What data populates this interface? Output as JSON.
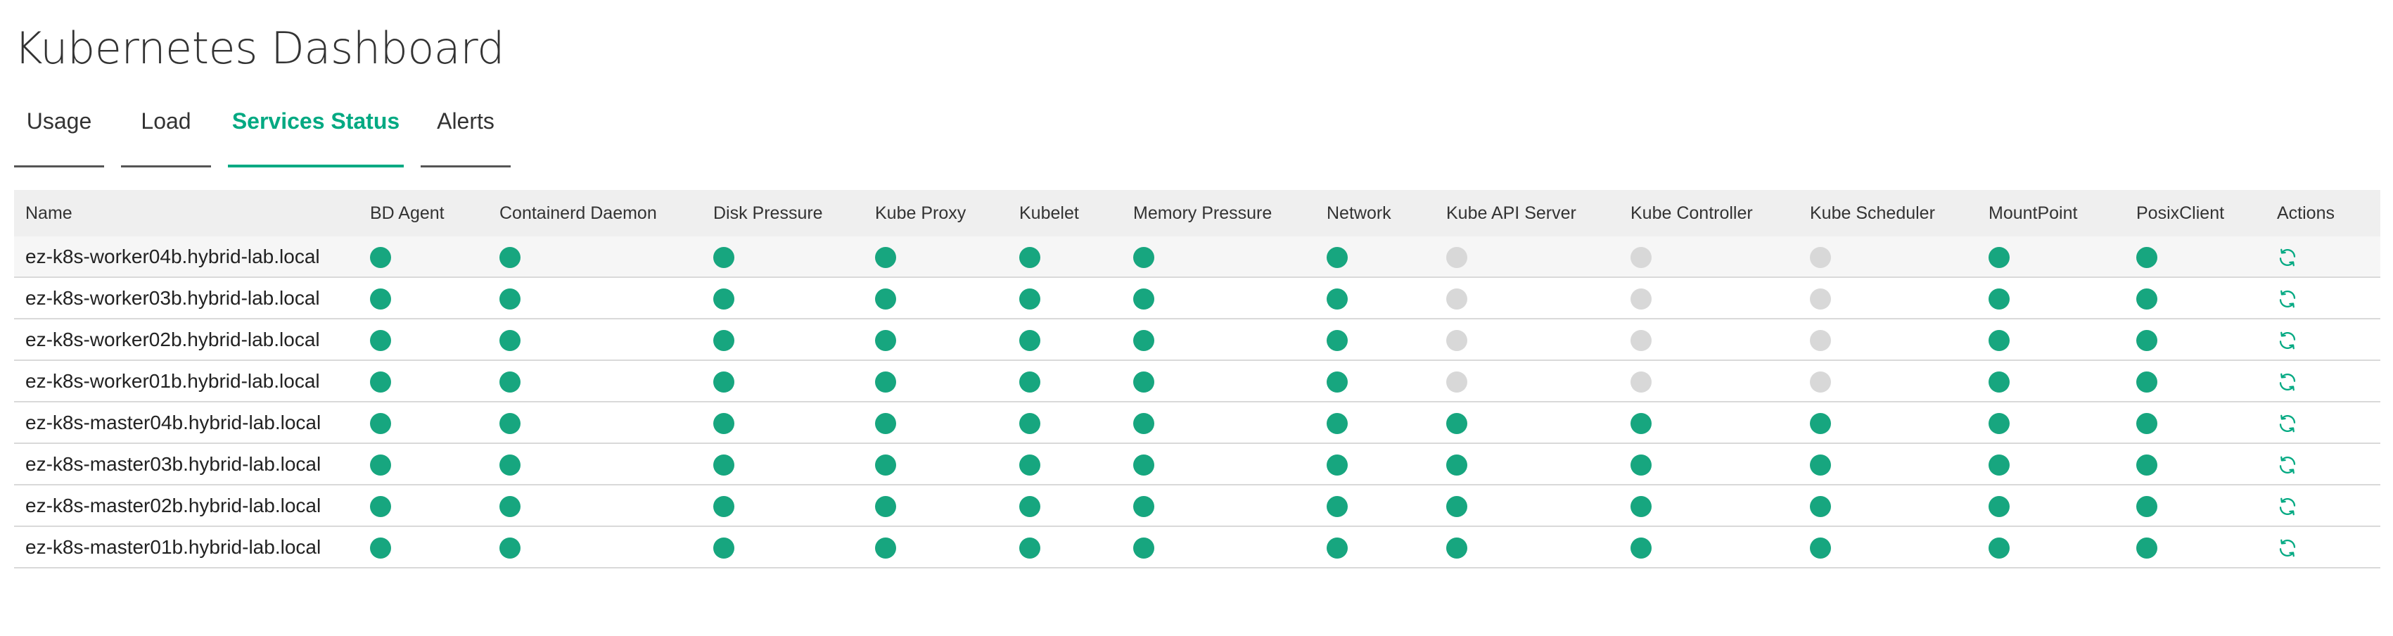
{
  "page": {
    "title": "Kubernetes Dashboard"
  },
  "tabs": [
    {
      "label": "Usage",
      "active": false
    },
    {
      "label": "Load",
      "active": false
    },
    {
      "label": "Services Status",
      "active": true
    },
    {
      "label": "Alerts",
      "active": false
    }
  ],
  "colors": {
    "accent": "#01a982",
    "status_ok": "#17a67f",
    "status_unknown": "#d8d8d8",
    "header_bg": "#efefef",
    "row_highlight": "#f6f6f6"
  },
  "table": {
    "columns": [
      "Name",
      "BD Agent",
      "Containerd Daemon",
      "Disk Pressure",
      "Kube Proxy",
      "Kubelet",
      "Memory Pressure",
      "Network",
      "Kube API Server",
      "Kube Controller",
      "Kube Scheduler",
      "MountPoint",
      "PosixClient",
      "Actions"
    ],
    "action_icon": "refresh-icon",
    "rows": [
      {
        "name": "ez-k8s-worker04b.hybrid-lab.local",
        "status": [
          "ok",
          "ok",
          "ok",
          "ok",
          "ok",
          "ok",
          "ok",
          "unknown",
          "unknown",
          "unknown",
          "ok",
          "ok"
        ]
      },
      {
        "name": "ez-k8s-worker03b.hybrid-lab.local",
        "status": [
          "ok",
          "ok",
          "ok",
          "ok",
          "ok",
          "ok",
          "ok",
          "unknown",
          "unknown",
          "unknown",
          "ok",
          "ok"
        ]
      },
      {
        "name": "ez-k8s-worker02b.hybrid-lab.local",
        "status": [
          "ok",
          "ok",
          "ok",
          "ok",
          "ok",
          "ok",
          "ok",
          "unknown",
          "unknown",
          "unknown",
          "ok",
          "ok"
        ]
      },
      {
        "name": "ez-k8s-worker01b.hybrid-lab.local",
        "status": [
          "ok",
          "ok",
          "ok",
          "ok",
          "ok",
          "ok",
          "ok",
          "unknown",
          "unknown",
          "unknown",
          "ok",
          "ok"
        ]
      },
      {
        "name": "ez-k8s-master04b.hybrid-lab.local",
        "status": [
          "ok",
          "ok",
          "ok",
          "ok",
          "ok",
          "ok",
          "ok",
          "ok",
          "ok",
          "ok",
          "ok",
          "ok"
        ]
      },
      {
        "name": "ez-k8s-master03b.hybrid-lab.local",
        "status": [
          "ok",
          "ok",
          "ok",
          "ok",
          "ok",
          "ok",
          "ok",
          "ok",
          "ok",
          "ok",
          "ok",
          "ok"
        ]
      },
      {
        "name": "ez-k8s-master02b.hybrid-lab.local",
        "status": [
          "ok",
          "ok",
          "ok",
          "ok",
          "ok",
          "ok",
          "ok",
          "ok",
          "ok",
          "ok",
          "ok",
          "ok"
        ]
      },
      {
        "name": "ez-k8s-master01b.hybrid-lab.local",
        "status": [
          "ok",
          "ok",
          "ok",
          "ok",
          "ok",
          "ok",
          "ok",
          "ok",
          "ok",
          "ok",
          "ok",
          "ok"
        ]
      }
    ]
  }
}
